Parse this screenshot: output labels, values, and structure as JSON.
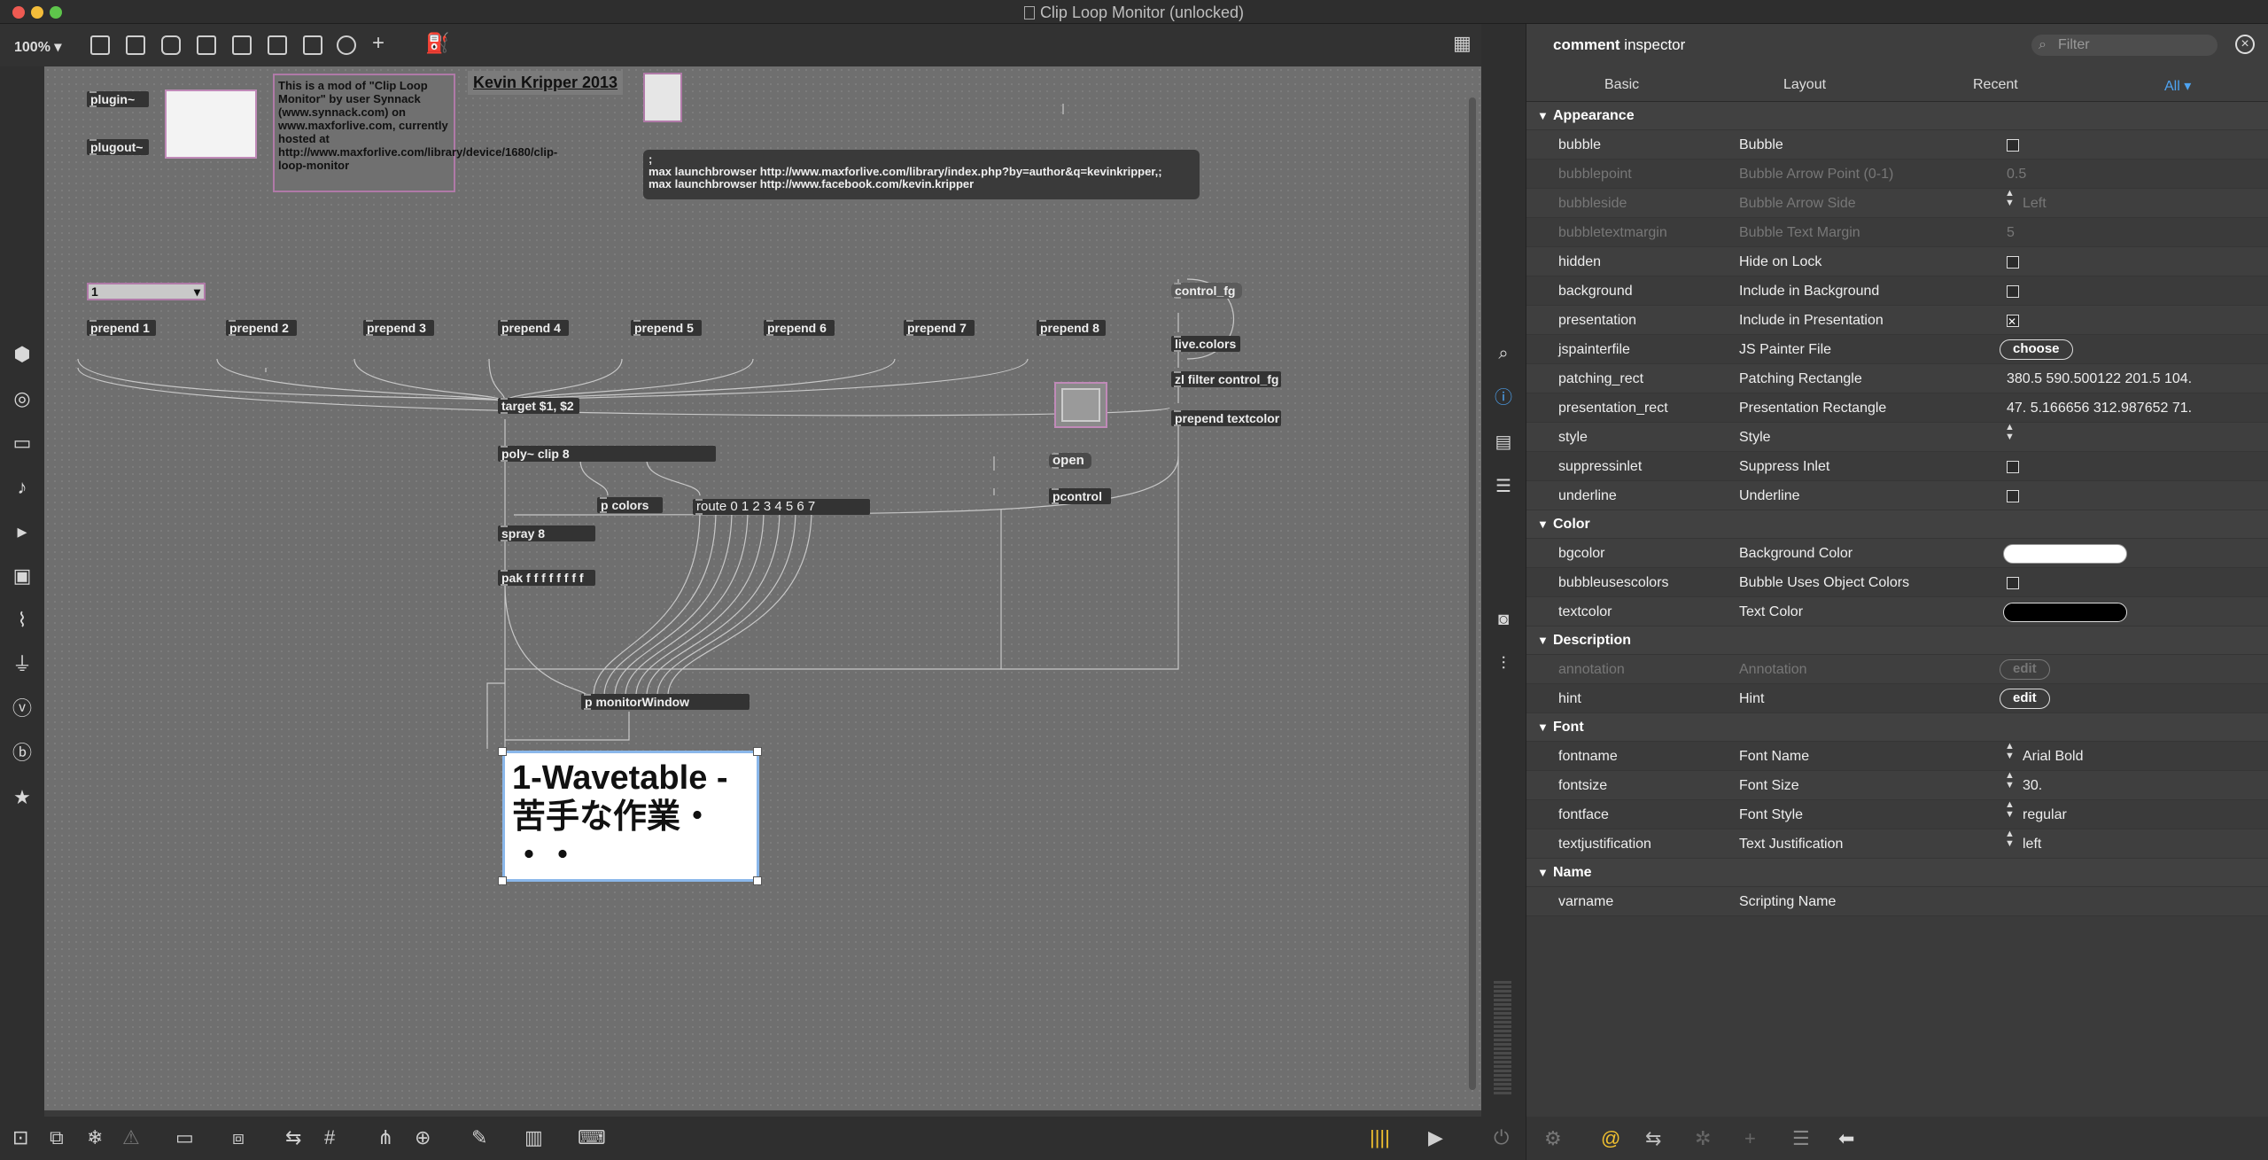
{
  "window": {
    "title": "Clip Loop Monitor (unlocked)"
  },
  "toolbar": {
    "zoom": "100%"
  },
  "patch": {
    "plugin": "plugin~",
    "plugout": "plugout~",
    "comment": "This is a mod of \"Clip Loop Monitor\" by user Synnack (www.synnack.com) on www.maxforlive.com, currently hosted at http://www.maxforlive.com/library/device/1680/clip-loop-monitor",
    "author": "Kevin Kripper 2013",
    "launch_msg": ";\nmax launchbrowser http://www.maxforlive.com/library/index.php?by=author&q=kevinkripper,;\nmax launchbrowser http://www.facebook.com/kevin.kripper",
    "menu_value": "1",
    "prepends": [
      "prepend 1",
      "prepend 2",
      "prepend 3",
      "prepend 4",
      "prepend 5",
      "prepend 6",
      "prepend 7",
      "prepend 8"
    ],
    "target": "target $1, $2",
    "poly": "poly~ clip 8",
    "pcolors": "p colors",
    "route": "route 0 1 2 3 4 5 6 7",
    "spray": "spray 8",
    "pak": "pak f f f f f f f f",
    "monitor": "p monitorWindow",
    "open": "open",
    "pcontrol": "pcontrol",
    "control_fg": "control_fg",
    "live_colors": "live.colors",
    "zl_filter": "zl filter control_fg",
    "prepend_textcolor": "prepend textcolor",
    "big_comment_line1": "1-Wavetable -",
    "big_comment_line2": "苦手な作業・",
    "big_comment_line3": "・・"
  },
  "inspector": {
    "title_bold": "comment",
    "title_rest": " inspector",
    "filter_placeholder": "Filter",
    "tabs": [
      "Basic",
      "Layout",
      "Recent",
      "All ▾"
    ],
    "sections": {
      "appearance": "Appearance",
      "color": "Color",
      "description": "Description",
      "font": "Font",
      "name": "Name"
    },
    "rows": {
      "bubble": [
        "bubble",
        "Bubble"
      ],
      "bubblepoint": [
        "bubblepoint",
        "Bubble Arrow Point (0-1)",
        "0.5"
      ],
      "bubbleside": [
        "bubbleside",
        "Bubble Arrow Side",
        "Left"
      ],
      "bubbletextmargin": [
        "bubbletextmargin",
        "Bubble Text Margin",
        "5"
      ],
      "hidden": [
        "hidden",
        "Hide on Lock"
      ],
      "background": [
        "background",
        "Include in Background"
      ],
      "presentation": [
        "presentation",
        "Include in Presentation"
      ],
      "jspainterfile": [
        "jspainterfile",
        "JS Painter File",
        "choose"
      ],
      "patching_rect": [
        "patching_rect",
        "Patching Rectangle",
        "380.5 590.500122 201.5 104."
      ],
      "presentation_rect": [
        "presentation_rect",
        "Presentation Rectangle",
        "47. 5.166656 312.987652 71."
      ],
      "style": [
        "style",
        "Style"
      ],
      "suppressinlet": [
        "suppressinlet",
        "Suppress Inlet"
      ],
      "underline": [
        "underline",
        "Underline"
      ],
      "bgcolor": [
        "bgcolor",
        "Background Color"
      ],
      "bubbleusescolors": [
        "bubbleusescolors",
        "Bubble Uses Object Colors"
      ],
      "textcolor": [
        "textcolor",
        "Text Color"
      ],
      "annotation": [
        "annotation",
        "Annotation",
        "edit"
      ],
      "hint": [
        "hint",
        "Hint",
        "edit"
      ],
      "fontname": [
        "fontname",
        "Font Name",
        "Arial Bold"
      ],
      "fontsize": [
        "fontsize",
        "Font Size",
        "30."
      ],
      "fontface": [
        "fontface",
        "Font Style",
        "regular"
      ],
      "textjustification": [
        "textjustification",
        "Text Justification",
        "left"
      ],
      "varname": [
        "varname",
        "Scripting Name"
      ]
    }
  },
  "colors": {
    "accent": "#4ea3f1",
    "bgcolor": "#ffffff",
    "textcolor": "#000000",
    "canvas": "#6f6f6f"
  }
}
